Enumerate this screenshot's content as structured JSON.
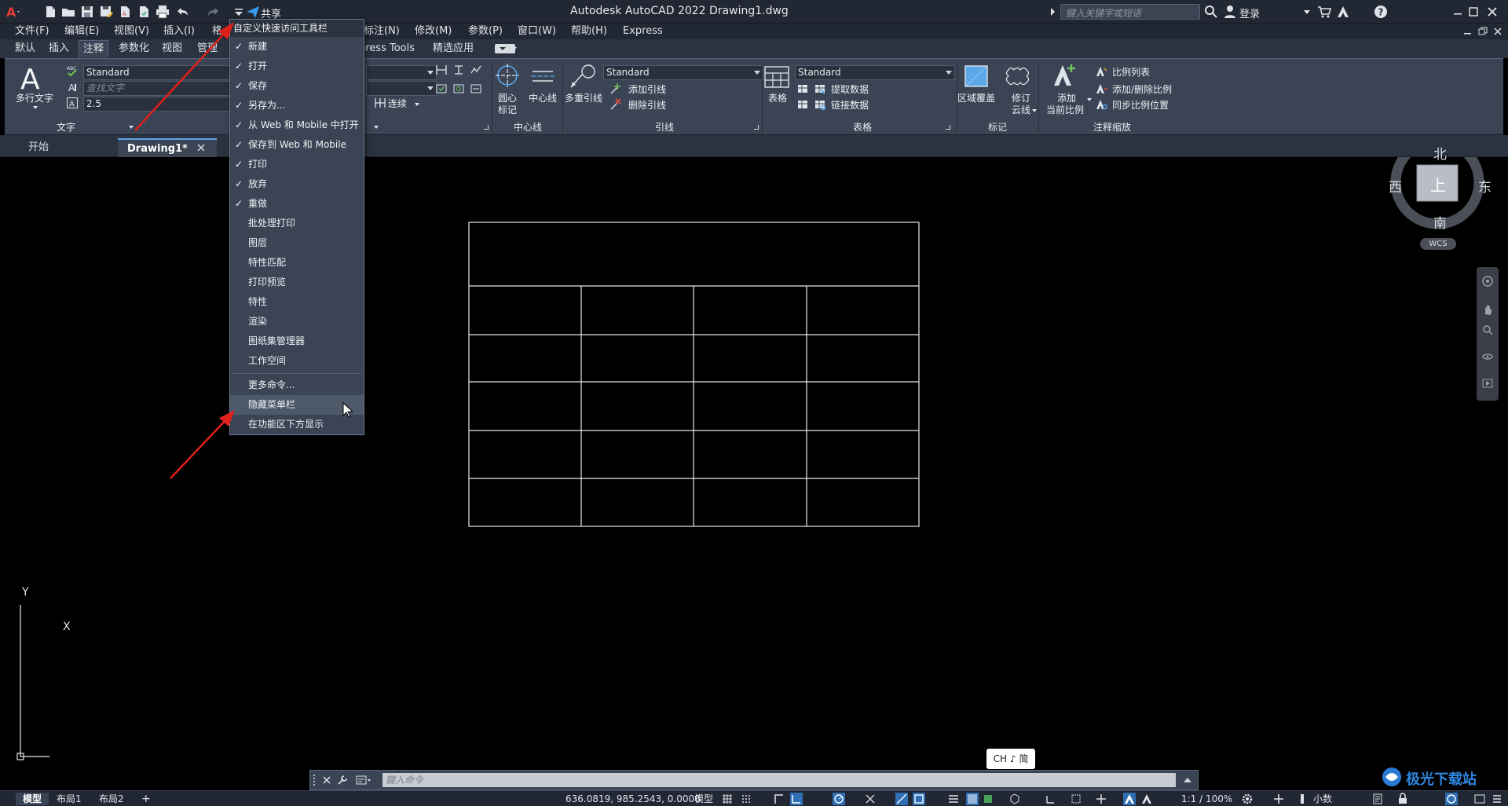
{
  "titlebar": {
    "app_title": "Autodesk AutoCAD 2022    Drawing1.dwg",
    "share_label": "共享",
    "search_placeholder": "键入关键字或短语",
    "login_label": "登录"
  },
  "menubar": {
    "items": [
      "文件(F)",
      "编辑(E)",
      "视图(V)",
      "插入(I)",
      "格",
      "标注(N)",
      "修改(M)",
      "参数(P)",
      "窗口(W)",
      "帮助(H)",
      "Express"
    ]
  },
  "ribbon_tabs": [
    "默认",
    "插入",
    "注释",
    "参数化",
    "视图",
    "管理",
    "press Tools",
    "精选应用"
  ],
  "active_ribbon_tab": "注释",
  "ribbon": {
    "text_panel": {
      "mtext_label": "多行文字",
      "style_value": "Standard",
      "find_placeholder": "查找文字",
      "height_value": "2.5",
      "title": "文字"
    },
    "dim_panel": {
      "continue_label": "连续"
    },
    "centerline_panel": {
      "center_mark_label_1": "圆心",
      "center_mark_label_2": "标记",
      "centerline_label": "中心线",
      "title": "中心线"
    },
    "leader_panel": {
      "multileader_label": "多重引线",
      "style_value": "Standard",
      "add_leader_label": "添加引线",
      "remove_leader_label": "删除引线",
      "title": "引线"
    },
    "table_panel": {
      "table_label": "表格",
      "style_value": "Standard",
      "extract_label": "提取数据",
      "link_label": "链接数据",
      "title": "表格"
    },
    "markup_panel": {
      "wipeout_label": "区域覆盖",
      "revcloud_label_1": "修订",
      "revcloud_label_2": "云线",
      "title": "标记"
    },
    "scale_panel": {
      "add_scale_label_1": "添加",
      "add_scale_label_2": "当前比例",
      "scale_list_label": "比例列表",
      "add_remove_label": "添加/删除比例",
      "sync_label": "同步比例位置",
      "title": "注释缩放"
    }
  },
  "file_tabs": {
    "start_label": "开始",
    "drawing_label": "Drawing1*"
  },
  "dropdown": {
    "header": "自定义快速访问工具栏",
    "items": [
      {
        "label": "新建",
        "checked": "✓"
      },
      {
        "label": "打开",
        "checked": "✓"
      },
      {
        "label": "保存",
        "checked": "✓"
      },
      {
        "label": "另存为...",
        "checked": "✓"
      },
      {
        "label": "从 Web 和 Mobile 中打开",
        "checked": "✓"
      },
      {
        "label": "保存到 Web 和 Mobile",
        "checked": "✓"
      },
      {
        "label": "打印",
        "checked": "✓"
      },
      {
        "label": "放弃",
        "checked": "✓"
      },
      {
        "label": "重做",
        "checked": "✓"
      },
      {
        "label": "批处理打印",
        "checked": ""
      },
      {
        "label": "图层",
        "checked": ""
      },
      {
        "label": "特性匹配",
        "checked": ""
      },
      {
        "label": "打印预览",
        "checked": ""
      },
      {
        "label": "特性",
        "checked": ""
      },
      {
        "label": "渲染",
        "checked": ""
      },
      {
        "label": "图纸集管理器",
        "checked": ""
      },
      {
        "label": "工作空间",
        "checked": ""
      }
    ],
    "more_commands": "更多命令...",
    "hide_menubar": "隐藏菜单栏",
    "show_below_ribbon": "在功能区下方显示"
  },
  "viewcube": {
    "north": "北",
    "south": "南",
    "east": "东",
    "west": "西",
    "top_face": "上",
    "wcs_label": "WCS"
  },
  "ucs": {
    "y_label": "Y",
    "x_label": "X"
  },
  "command_line": {
    "placeholder": "键入命令"
  },
  "ime_indicator": "CH ♪ 简",
  "statusbar": {
    "tabs": [
      "模型",
      "布局1",
      "布局2"
    ],
    "coordinates": "636.0819, 985.2543, 0.0000",
    "model_label": "模型",
    "scale_label": "1:1 / 100%",
    "units_label": "小数"
  },
  "watermark": {
    "text": "极光下载站"
  },
  "colors": {
    "title_bg": "#212733",
    "ribbon_bg": "#3a4454",
    "accent": "#e03c31",
    "arrow": "#e0201a"
  }
}
